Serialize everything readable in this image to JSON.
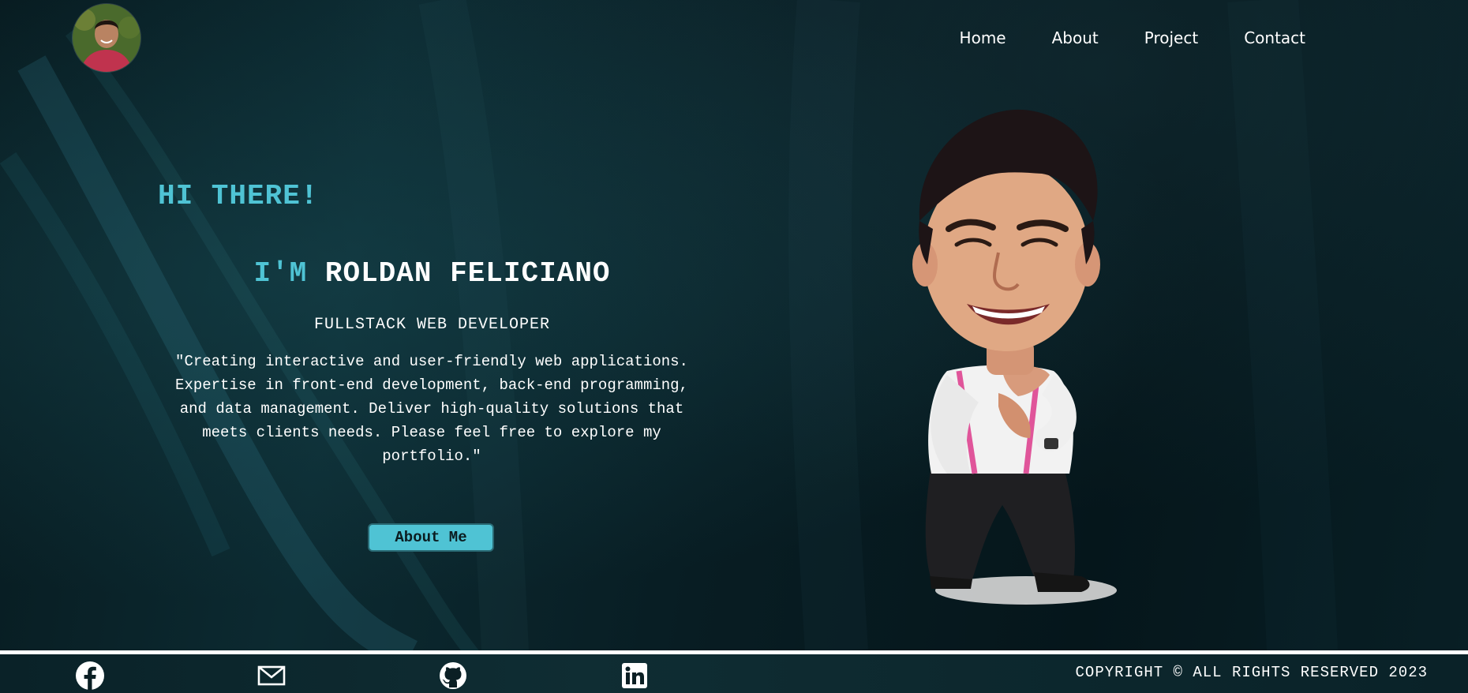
{
  "nav": {
    "items": [
      {
        "label": "Home"
      },
      {
        "label": "About"
      },
      {
        "label": "Project"
      },
      {
        "label": "Contact"
      }
    ]
  },
  "hero": {
    "greeting": "HI THERE!",
    "im": "I'M",
    "name": "ROLDAN FELICIANO",
    "role": "FULLSTACK WEB DEVELOPER",
    "quote": "\"Creating interactive and user-friendly web applications. Expertise in front-end development, back-end programming, and data management. Deliver high-quality solutions that meets clients needs. Please feel free to explore my portfolio.\"",
    "button_label": "About Me"
  },
  "footer": {
    "social": [
      {
        "icon": "facebook-icon"
      },
      {
        "icon": "mail-icon"
      },
      {
        "icon": "github-icon"
      },
      {
        "icon": "linkedin-icon"
      }
    ],
    "copyright": "COPYRIGHT © ALL RIGHTS RESERVED 2023"
  },
  "colors": {
    "accent": "#4fc3d4",
    "background": "#0a2228",
    "text": "#ffffff"
  }
}
